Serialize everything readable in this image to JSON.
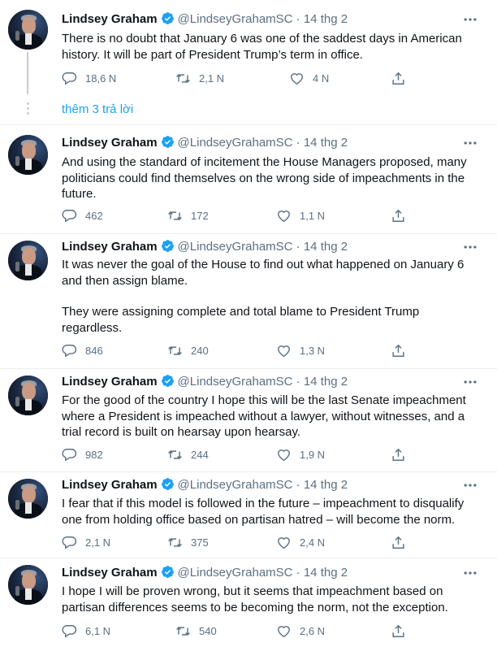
{
  "author": {
    "name": "Lindsey Graham",
    "handle": "@LindseyGrahamSC",
    "dot": "·"
  },
  "show_more_replies": "thêm 3 trả lời",
  "tweets": [
    {
      "date": "14 thg 2",
      "paragraphs": [
        "There is no doubt that January 6 was one of the saddest days in American history.  It will be part of President Trump’s term in office."
      ],
      "replies": "18,6 N",
      "retweets": "2,1 N",
      "likes": "4 N"
    },
    {
      "date": "14 thg 2",
      "paragraphs": [
        "And using the standard of incitement the House Managers proposed, many politicians could find themselves on the wrong side of impeachments in the future."
      ],
      "replies": "462",
      "retweets": "172",
      "likes": "1,1 N"
    },
    {
      "date": "14 thg 2",
      "paragraphs": [
        "It was never the goal of the House to find out what happened on January 6 and then assign blame.",
        "They were assigning complete and total blame to President Trump regardless."
      ],
      "replies": "846",
      "retweets": "240",
      "likes": "1,3 N"
    },
    {
      "date": "14 thg 2",
      "paragraphs": [
        "For the good of the country I hope this will be the last Senate impeachment where a President is impeached without a lawyer, without witnesses, and a trial record is built on hearsay upon hearsay."
      ],
      "replies": "982",
      "retweets": "244",
      "likes": "1,9 N"
    },
    {
      "date": "14 thg 2",
      "paragraphs": [
        "I fear that if this model is followed in the future – impeachment to disqualify one from holding office based on partisan hatred – will become the norm."
      ],
      "replies": "2,1 N",
      "retweets": "375",
      "likes": "2,4 N"
    },
    {
      "date": "14 thg 2",
      "paragraphs": [
        "I hope I will be proven wrong, but it seems that impeachment based on partisan differences seems to be becoming the norm, not the exception."
      ],
      "replies": "6,1 N",
      "retweets": "540",
      "likes": "2,6 N"
    }
  ],
  "colors": {
    "verified": "#1da1f2",
    "link": "#1da1f2",
    "secondary_text": "#5b7083",
    "separator": "#ebeef0"
  },
  "icons": [
    "verified-badge-icon",
    "more-options-icon",
    "reply-icon",
    "retweet-icon",
    "like-icon",
    "share-icon"
  ]
}
